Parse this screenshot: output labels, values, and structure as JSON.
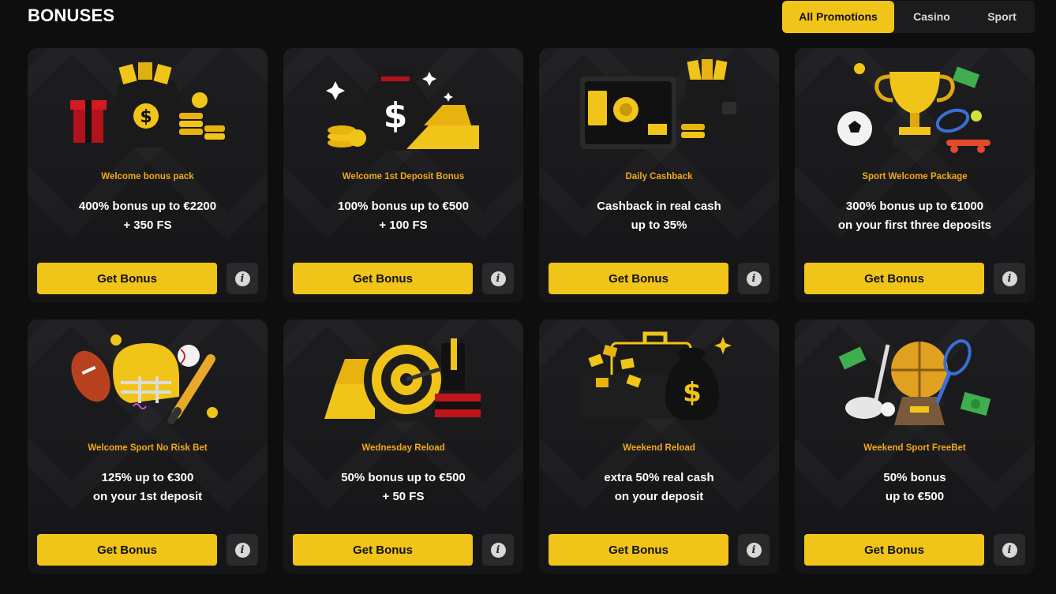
{
  "page": {
    "title": "BONUSES"
  },
  "tabs": [
    {
      "label": "All Promotions",
      "active": true
    },
    {
      "label": "Casino",
      "active": false
    },
    {
      "label": "Sport",
      "active": false
    }
  ],
  "colors": {
    "accent": "#f0c419",
    "label": "#f0a81c",
    "background": "#0e0e0f",
    "card": "#1b1b1d"
  },
  "cards": [
    {
      "label": "Welcome bonus pack",
      "line1": "400% bonus up to €2200",
      "line2": "+ 350 FS",
      "button": "Get Bonus",
      "icon": "money-bag-gift-icon"
    },
    {
      "label": "Welcome 1st Deposit Bonus",
      "line1": "100% bonus up to €500",
      "line2": "+ 100 FS",
      "button": "Get Bonus",
      "icon": "money-bag-gold-bars-icon"
    },
    {
      "label": "Daily Cashback",
      "line1": "Cashback in real cash",
      "line2": "up to 35%",
      "button": "Get Bonus",
      "icon": "safe-wallet-icon"
    },
    {
      "label": "Sport Welcome Package",
      "line1": "300% bonus up to €1000",
      "line2": "on your first three deposits",
      "button": "Get Bonus",
      "icon": "trophy-sports-icon"
    },
    {
      "label": "Welcome Sport No Risk Bet",
      "line1": "125% up to €300",
      "line2": "on your 1st deposit",
      "button": "Get Bonus",
      "icon": "football-helmet-icon"
    },
    {
      "label": "Wednesday Reload",
      "line1": "50% bonus up to €500",
      "line2": "+ 50 FS",
      "button": "Get Bonus",
      "icon": "target-dart-icon"
    },
    {
      "label": "Weekend Reload",
      "line1": "extra 50% real cash",
      "line2": "on your deposit",
      "button": "Get Bonus",
      "icon": "suitcase-money-bag-icon"
    },
    {
      "label": "Weekend Sport FreeBet",
      "line1": "50% bonus",
      "line2": "up to €500",
      "button": "Get Bonus",
      "icon": "sports-trophy-cash-icon"
    }
  ]
}
